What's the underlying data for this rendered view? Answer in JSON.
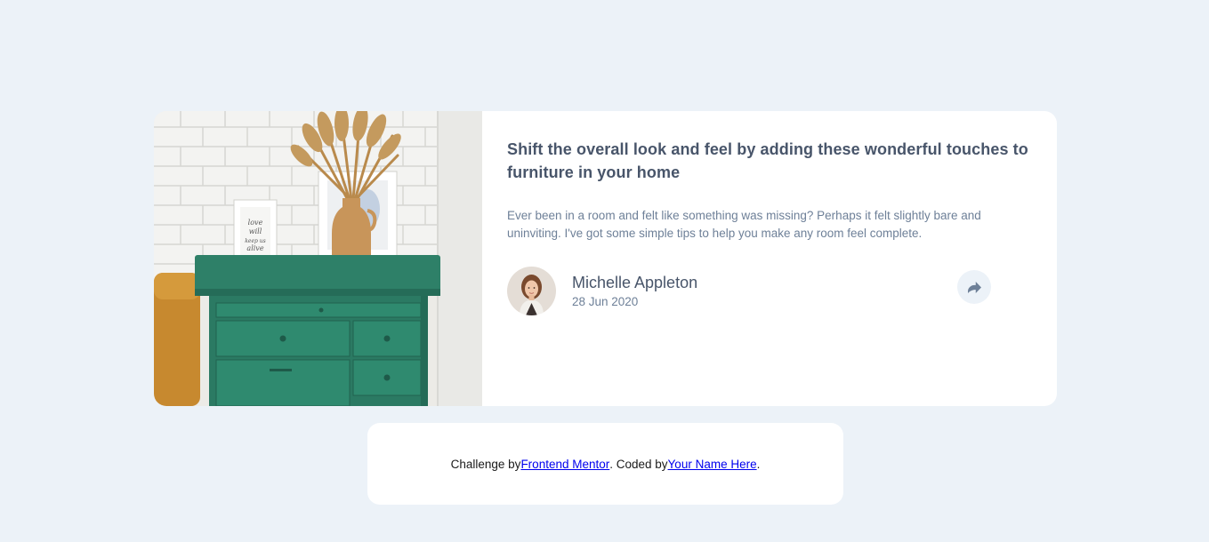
{
  "article": {
    "headline": "Shift the overall look and feel by adding these wonderful touches to furniture in your home",
    "summary": "Ever been in a room and felt like something was missing? Perhaps it felt slightly bare and uninviting. I've got some simple tips to help you make any room feel complete.",
    "author_name": "Michelle Appleton",
    "date": "28 Jun 2020",
    "share_icon": "share-icon"
  },
  "attribution": {
    "prefix": "Challenge by",
    "link1": " Frontend Mentor",
    "middle": ". Coded by",
    "link2": " Your Name Here",
    "suffix": "."
  },
  "colors": {
    "page_background": "#ecf2f8",
    "heading": "#48556a",
    "body_text": "#6e8098",
    "dresser_green": "#2b7a63"
  }
}
